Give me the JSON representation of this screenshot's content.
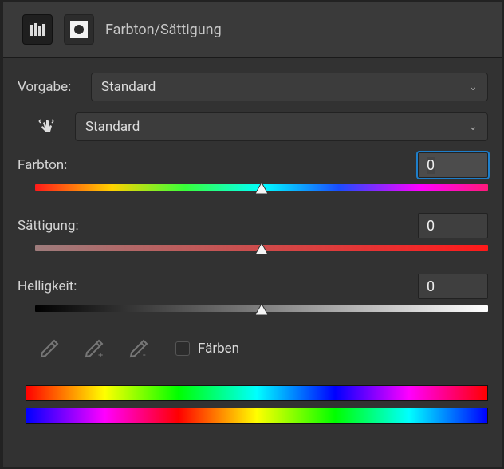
{
  "header": {
    "title": "Farbton/Sättigung"
  },
  "preset": {
    "label": "Vorgabe:",
    "value": "Standard"
  },
  "channel": {
    "value": "Standard"
  },
  "sliders": {
    "hue": {
      "label": "Farbton:",
      "value": "0"
    },
    "saturation": {
      "label": "Sättigung:",
      "value": "0"
    },
    "lightness": {
      "label": "Helligkeit:",
      "value": "0"
    }
  },
  "colorize": {
    "label": "Färben",
    "checked": false
  }
}
